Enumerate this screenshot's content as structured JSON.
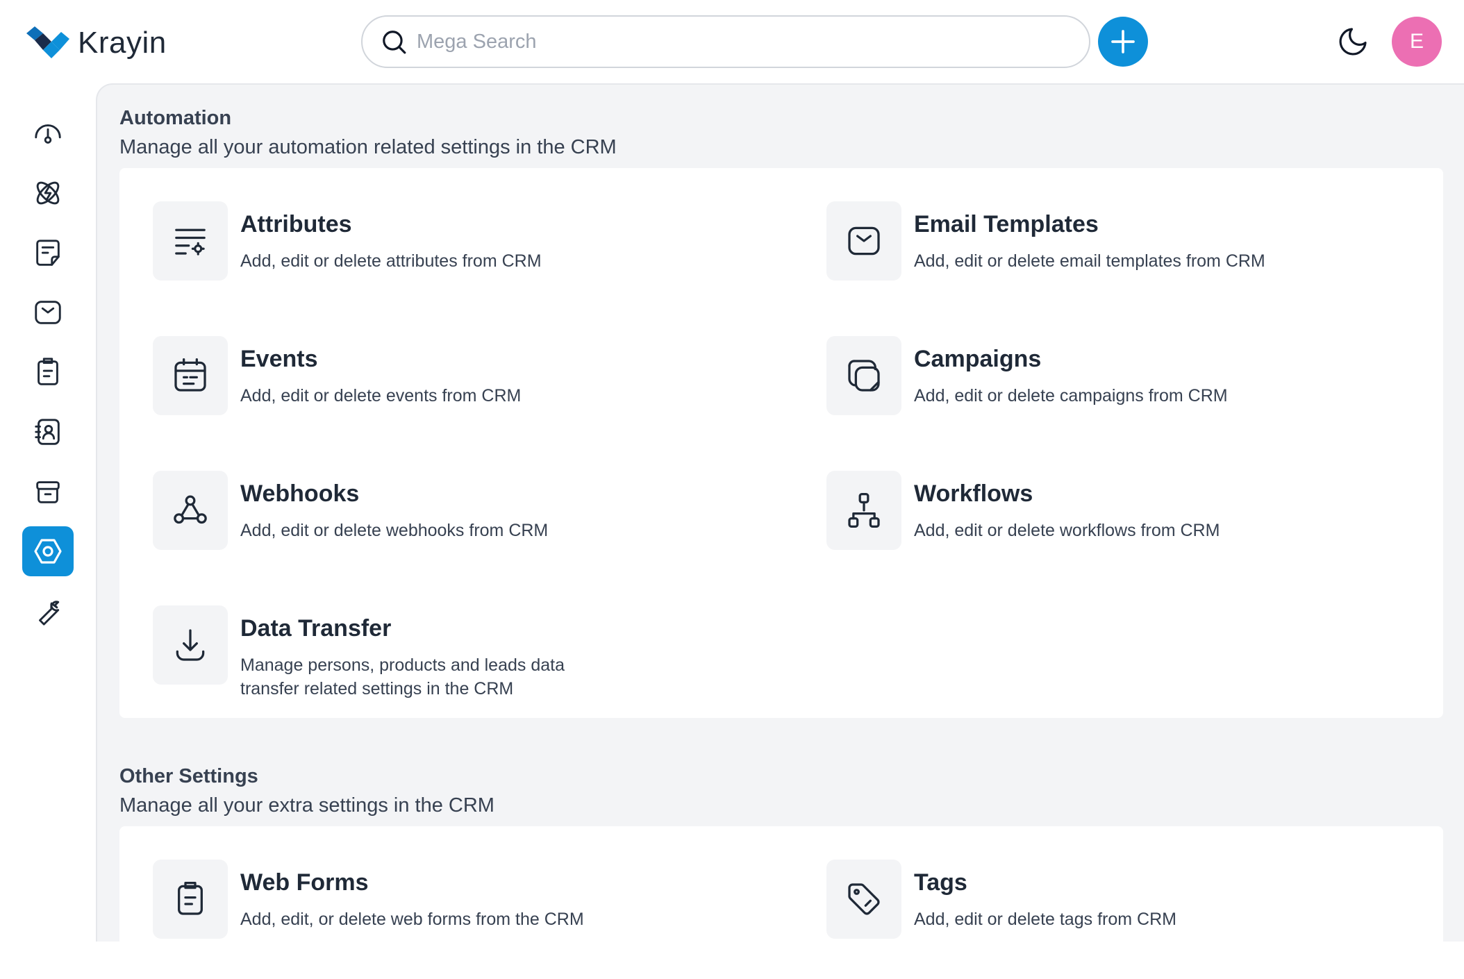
{
  "app": {
    "name": "Krayin"
  },
  "search": {
    "placeholder": "Mega Search"
  },
  "user": {
    "initial": "E"
  },
  "colors": {
    "accent": "#0e90d9",
    "avatar": "#ec6fb3",
    "background": "#f3f4f6"
  },
  "sidebar": {
    "items": [
      {
        "name": "dashboard",
        "icon": "dashboard-icon"
      },
      {
        "name": "leads",
        "icon": "leads-icon"
      },
      {
        "name": "quotes",
        "icon": "quotes-icon"
      },
      {
        "name": "mail",
        "icon": "mail-icon"
      },
      {
        "name": "activities",
        "icon": "activities-icon"
      },
      {
        "name": "contacts",
        "icon": "contacts-icon"
      },
      {
        "name": "products",
        "icon": "products-icon"
      },
      {
        "name": "settings",
        "icon": "settings-icon",
        "active": true
      },
      {
        "name": "configuration",
        "icon": "wrench-icon"
      }
    ]
  },
  "sections": [
    {
      "title": "Automation",
      "subtitle": "Manage all your automation related settings in the CRM",
      "tiles": [
        {
          "title": "Attributes",
          "desc": "Add, edit or delete attributes from CRM",
          "icon": "attributes-icon"
        },
        {
          "title": "Email Templates",
          "desc": "Add, edit or delete email templates from CRM",
          "icon": "email-template-icon"
        },
        {
          "title": "Events",
          "desc": "Add, edit or delete events from CRM",
          "icon": "calendar-icon"
        },
        {
          "title": "Campaigns",
          "desc": "Add, edit or delete campaigns from CRM",
          "icon": "campaign-icon"
        },
        {
          "title": "Webhooks",
          "desc": "Add, edit or delete webhooks from CRM",
          "icon": "webhook-icon"
        },
        {
          "title": "Workflows",
          "desc": "Add, edit or delete workflows from CRM",
          "icon": "workflow-icon"
        },
        {
          "title": "Data Transfer",
          "desc": "Manage persons, products and leads data transfer related settings in the CRM",
          "icon": "download-icon"
        }
      ]
    },
    {
      "title": "Other Settings",
      "subtitle": "Manage all your extra settings in the CRM",
      "tiles": [
        {
          "title": "Web Forms",
          "desc": "Add, edit, or delete web forms from the CRM",
          "icon": "web-form-icon"
        },
        {
          "title": "Tags",
          "desc": "Add, edit or delete tags from CRM",
          "icon": "tag-icon"
        }
      ]
    }
  ]
}
